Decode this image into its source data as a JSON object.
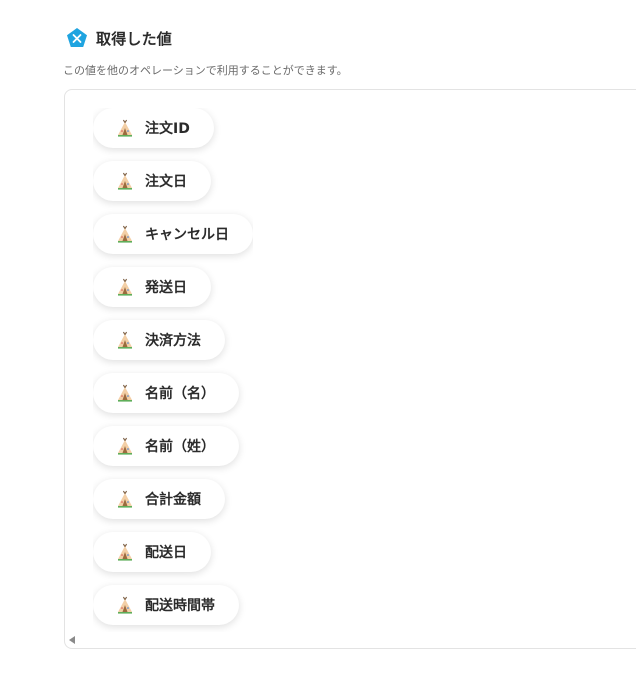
{
  "section": {
    "icon": "pentagon-x-icon",
    "title": "取得した値",
    "description": "この値を他のオペレーションで利用することができます。"
  },
  "items": [
    {
      "label": "注文ID",
      "icon": "teepee-icon"
    },
    {
      "label": "注文日",
      "icon": "teepee-icon"
    },
    {
      "label": "キャンセル日",
      "icon": "teepee-icon"
    },
    {
      "label": "発送日",
      "icon": "teepee-icon"
    },
    {
      "label": "決済方法",
      "icon": "teepee-icon"
    },
    {
      "label": "名前（名）",
      "icon": "teepee-icon"
    },
    {
      "label": "名前（姓）",
      "icon": "teepee-icon"
    },
    {
      "label": "合計金額",
      "icon": "teepee-icon"
    },
    {
      "label": "配送日",
      "icon": "teepee-icon"
    },
    {
      "label": "配送時間帯",
      "icon": "teepee-icon"
    }
  ],
  "colors": {
    "accent": "#1fa4e0",
    "text": "#2b2b2b",
    "muted": "#6b6b6b"
  }
}
